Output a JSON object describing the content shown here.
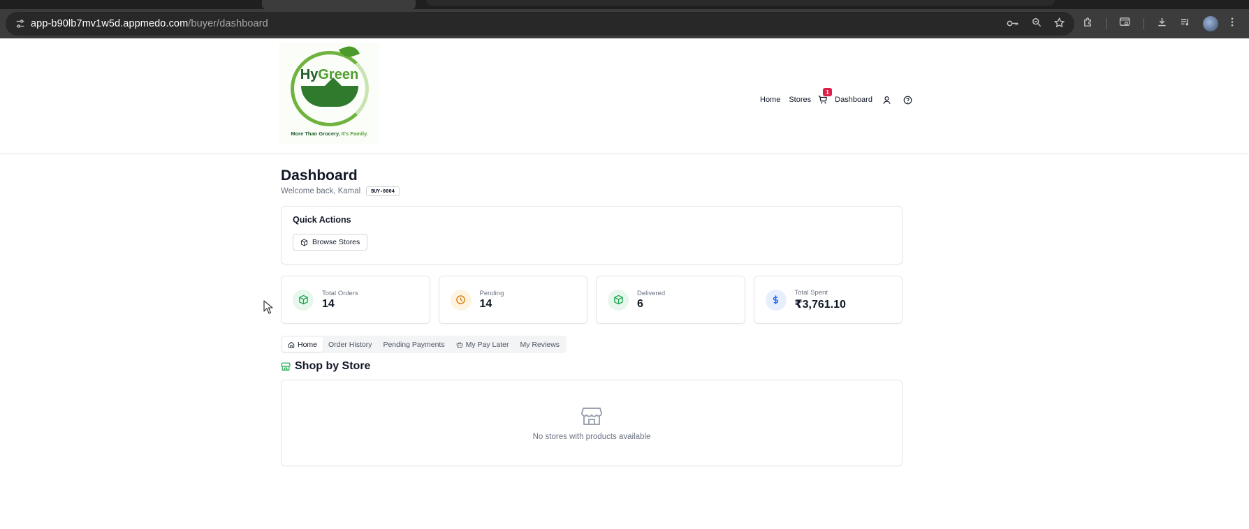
{
  "browser": {
    "url_host": "app-b90lb7mv1w5d.appmedo.com",
    "url_path": "/buyer/dashboard"
  },
  "logo": {
    "word_hy": "Hy",
    "word_green": "Green",
    "tagline_main": "More Than Grocery,",
    "tagline_family": "It's Family."
  },
  "nav": {
    "home": "Home",
    "stores": "Stores",
    "cart_count": "1",
    "dashboard": "Dashboard"
  },
  "dashboard": {
    "title": "Dashboard",
    "welcome": "Welcome back, Kamal",
    "buyer_id": "BUY-0004"
  },
  "quick_actions": {
    "title": "Quick Actions",
    "browse_label": "Browse Stores"
  },
  "stats": [
    {
      "label": "Total Orders",
      "value": "14",
      "color": "#16a34a",
      "bg": "#e8f7ee"
    },
    {
      "label": "Pending",
      "value": "14",
      "color": "#d97706",
      "bg": "#fdf3e1"
    },
    {
      "label": "Delivered",
      "value": "6",
      "color": "#16a34a",
      "bg": "#e8f7ee"
    },
    {
      "label": "Total Spent",
      "value": "₹3,761.10",
      "color": "#2563eb",
      "bg": "#e8effc"
    }
  ],
  "tabs": [
    {
      "label": "Home"
    },
    {
      "label": "Order History"
    },
    {
      "label": "Pending Payments"
    },
    {
      "label": "My Pay Later"
    },
    {
      "label": "My Reviews"
    }
  ],
  "shop": {
    "title": "Shop by Store",
    "empty_text": "No stores with products available"
  },
  "colors": {
    "brand_green": "#16a34a",
    "badge_red": "#e11d48"
  }
}
